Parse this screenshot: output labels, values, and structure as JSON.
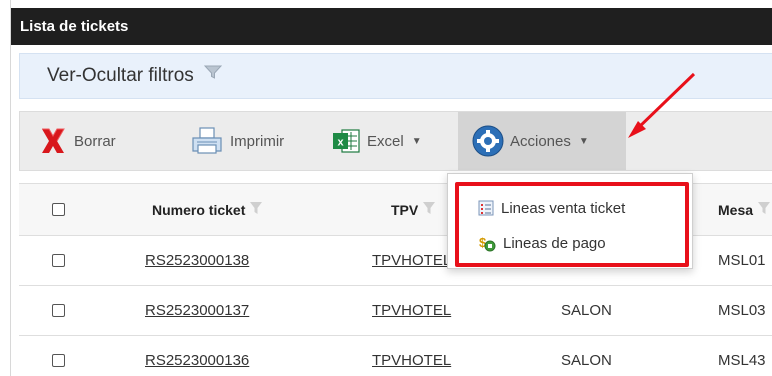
{
  "window": {
    "title": "Lista de tickets"
  },
  "filters": {
    "toggle_label": "Ver-Ocultar filtros",
    "icon": "funnel-icon"
  },
  "toolbar": {
    "delete_label": "Borrar",
    "print_label": "Imprimir",
    "excel_label": "Excel",
    "actions_label": "Acciones"
  },
  "actions_menu": {
    "items": [
      {
        "label": "Lineas venta ticket",
        "icon": "list-icon"
      },
      {
        "label": "Lineas de pago",
        "icon": "payment-icon"
      }
    ]
  },
  "table": {
    "columns": [
      "Numero ticket",
      "TPV",
      "Mesa"
    ],
    "rows": [
      {
        "ticket": "RS2523000138",
        "tpv": "TPVHOTEL",
        "zone": "",
        "mesa": "MSL01"
      },
      {
        "ticket": "RS2523000137",
        "tpv": "TPVHOTEL",
        "zone": "SALON",
        "mesa": "MSL03"
      },
      {
        "ticket": "RS2523000136",
        "tpv": "TPVHOTEL",
        "zone": "SALON",
        "mesa": "MSL43"
      }
    ]
  },
  "colors": {
    "title_bg": "#1f1f1f",
    "filter_bg": "#e9f1fb",
    "toolbar_bg": "#ececec",
    "highlight": "#e8101a"
  }
}
